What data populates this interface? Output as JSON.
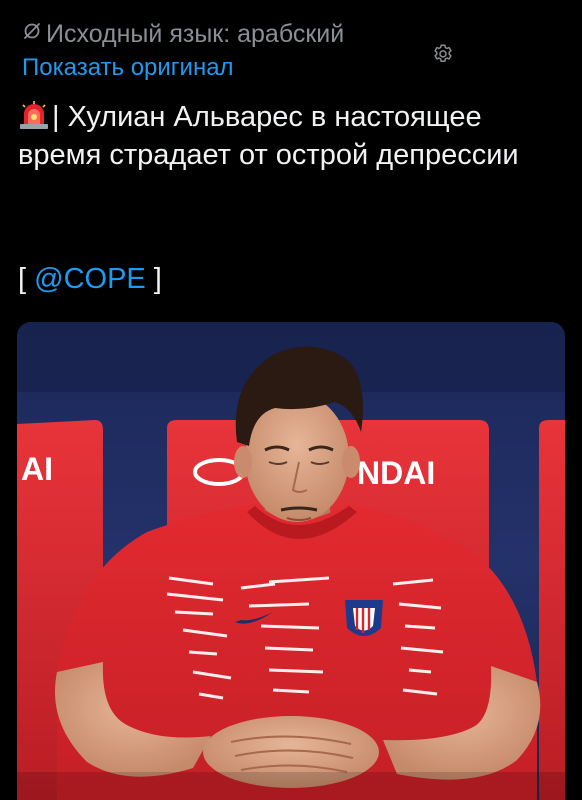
{
  "translation": {
    "source_language_label": "Исходный язык: арабский",
    "show_original_label": "Показать оригинал"
  },
  "tweet": {
    "text_separator": "|",
    "text": "Хулиан Альварес в настоящее время страдает от острой депрессии",
    "source_open_bracket": "[ ",
    "source_mention": "@COPE",
    "source_close_bracket": " ]"
  },
  "photo": {
    "seat_brand_left": "AI",
    "seat_brand_right": "NDAI"
  },
  "colors": {
    "background": "#000000",
    "link": "#1d9bf0",
    "muted_text": "#8b8f94",
    "body_text": "#f1f2f3",
    "jersey_red": "#d8242b"
  },
  "icons": {
    "language": "no-language-icon",
    "settings": "gear-icon",
    "alert": "police-siren-emoji"
  }
}
